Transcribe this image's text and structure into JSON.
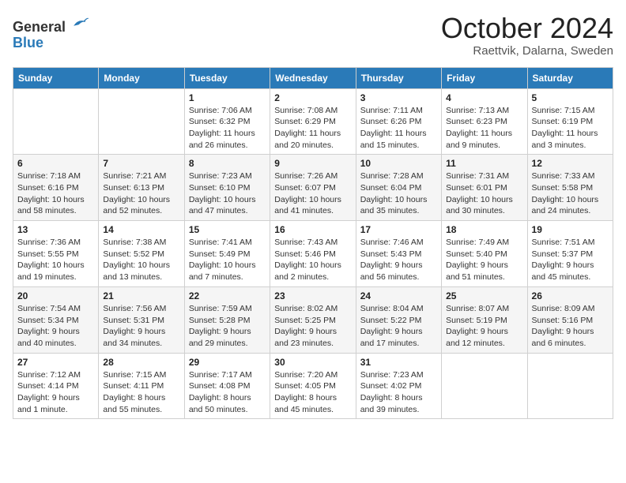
{
  "logo": {
    "general": "General",
    "blue": "Blue"
  },
  "header": {
    "month": "October 2024",
    "location": "Raettvik, Dalarna, Sweden"
  },
  "weekdays": [
    "Sunday",
    "Monday",
    "Tuesday",
    "Wednesday",
    "Thursday",
    "Friday",
    "Saturday"
  ],
  "weeks": [
    [
      {
        "day": "",
        "sunrise": "",
        "sunset": "",
        "daylight": ""
      },
      {
        "day": "",
        "sunrise": "",
        "sunset": "",
        "daylight": ""
      },
      {
        "day": "1",
        "sunrise": "Sunrise: 7:06 AM",
        "sunset": "Sunset: 6:32 PM",
        "daylight": "Daylight: 11 hours and 26 minutes."
      },
      {
        "day": "2",
        "sunrise": "Sunrise: 7:08 AM",
        "sunset": "Sunset: 6:29 PM",
        "daylight": "Daylight: 11 hours and 20 minutes."
      },
      {
        "day": "3",
        "sunrise": "Sunrise: 7:11 AM",
        "sunset": "Sunset: 6:26 PM",
        "daylight": "Daylight: 11 hours and 15 minutes."
      },
      {
        "day": "4",
        "sunrise": "Sunrise: 7:13 AM",
        "sunset": "Sunset: 6:23 PM",
        "daylight": "Daylight: 11 hours and 9 minutes."
      },
      {
        "day": "5",
        "sunrise": "Sunrise: 7:15 AM",
        "sunset": "Sunset: 6:19 PM",
        "daylight": "Daylight: 11 hours and 3 minutes."
      }
    ],
    [
      {
        "day": "6",
        "sunrise": "Sunrise: 7:18 AM",
        "sunset": "Sunset: 6:16 PM",
        "daylight": "Daylight: 10 hours and 58 minutes."
      },
      {
        "day": "7",
        "sunrise": "Sunrise: 7:21 AM",
        "sunset": "Sunset: 6:13 PM",
        "daylight": "Daylight: 10 hours and 52 minutes."
      },
      {
        "day": "8",
        "sunrise": "Sunrise: 7:23 AM",
        "sunset": "Sunset: 6:10 PM",
        "daylight": "Daylight: 10 hours and 47 minutes."
      },
      {
        "day": "9",
        "sunrise": "Sunrise: 7:26 AM",
        "sunset": "Sunset: 6:07 PM",
        "daylight": "Daylight: 10 hours and 41 minutes."
      },
      {
        "day": "10",
        "sunrise": "Sunrise: 7:28 AM",
        "sunset": "Sunset: 6:04 PM",
        "daylight": "Daylight: 10 hours and 35 minutes."
      },
      {
        "day": "11",
        "sunrise": "Sunrise: 7:31 AM",
        "sunset": "Sunset: 6:01 PM",
        "daylight": "Daylight: 10 hours and 30 minutes."
      },
      {
        "day": "12",
        "sunrise": "Sunrise: 7:33 AM",
        "sunset": "Sunset: 5:58 PM",
        "daylight": "Daylight: 10 hours and 24 minutes."
      }
    ],
    [
      {
        "day": "13",
        "sunrise": "Sunrise: 7:36 AM",
        "sunset": "Sunset: 5:55 PM",
        "daylight": "Daylight: 10 hours and 19 minutes."
      },
      {
        "day": "14",
        "sunrise": "Sunrise: 7:38 AM",
        "sunset": "Sunset: 5:52 PM",
        "daylight": "Daylight: 10 hours and 13 minutes."
      },
      {
        "day": "15",
        "sunrise": "Sunrise: 7:41 AM",
        "sunset": "Sunset: 5:49 PM",
        "daylight": "Daylight: 10 hours and 7 minutes."
      },
      {
        "day": "16",
        "sunrise": "Sunrise: 7:43 AM",
        "sunset": "Sunset: 5:46 PM",
        "daylight": "Daylight: 10 hours and 2 minutes."
      },
      {
        "day": "17",
        "sunrise": "Sunrise: 7:46 AM",
        "sunset": "Sunset: 5:43 PM",
        "daylight": "Daylight: 9 hours and 56 minutes."
      },
      {
        "day": "18",
        "sunrise": "Sunrise: 7:49 AM",
        "sunset": "Sunset: 5:40 PM",
        "daylight": "Daylight: 9 hours and 51 minutes."
      },
      {
        "day": "19",
        "sunrise": "Sunrise: 7:51 AM",
        "sunset": "Sunset: 5:37 PM",
        "daylight": "Daylight: 9 hours and 45 minutes."
      }
    ],
    [
      {
        "day": "20",
        "sunrise": "Sunrise: 7:54 AM",
        "sunset": "Sunset: 5:34 PM",
        "daylight": "Daylight: 9 hours and 40 minutes."
      },
      {
        "day": "21",
        "sunrise": "Sunrise: 7:56 AM",
        "sunset": "Sunset: 5:31 PM",
        "daylight": "Daylight: 9 hours and 34 minutes."
      },
      {
        "day": "22",
        "sunrise": "Sunrise: 7:59 AM",
        "sunset": "Sunset: 5:28 PM",
        "daylight": "Daylight: 9 hours and 29 minutes."
      },
      {
        "day": "23",
        "sunrise": "Sunrise: 8:02 AM",
        "sunset": "Sunset: 5:25 PM",
        "daylight": "Daylight: 9 hours and 23 minutes."
      },
      {
        "day": "24",
        "sunrise": "Sunrise: 8:04 AM",
        "sunset": "Sunset: 5:22 PM",
        "daylight": "Daylight: 9 hours and 17 minutes."
      },
      {
        "day": "25",
        "sunrise": "Sunrise: 8:07 AM",
        "sunset": "Sunset: 5:19 PM",
        "daylight": "Daylight: 9 hours and 12 minutes."
      },
      {
        "day": "26",
        "sunrise": "Sunrise: 8:09 AM",
        "sunset": "Sunset: 5:16 PM",
        "daylight": "Daylight: 9 hours and 6 minutes."
      }
    ],
    [
      {
        "day": "27",
        "sunrise": "Sunrise: 7:12 AM",
        "sunset": "Sunset: 4:14 PM",
        "daylight": "Daylight: 9 hours and 1 minute."
      },
      {
        "day": "28",
        "sunrise": "Sunrise: 7:15 AM",
        "sunset": "Sunset: 4:11 PM",
        "daylight": "Daylight: 8 hours and 55 minutes."
      },
      {
        "day": "29",
        "sunrise": "Sunrise: 7:17 AM",
        "sunset": "Sunset: 4:08 PM",
        "daylight": "Daylight: 8 hours and 50 minutes."
      },
      {
        "day": "30",
        "sunrise": "Sunrise: 7:20 AM",
        "sunset": "Sunset: 4:05 PM",
        "daylight": "Daylight: 8 hours and 45 minutes."
      },
      {
        "day": "31",
        "sunrise": "Sunrise: 7:23 AM",
        "sunset": "Sunset: 4:02 PM",
        "daylight": "Daylight: 8 hours and 39 minutes."
      },
      {
        "day": "",
        "sunrise": "",
        "sunset": "",
        "daylight": ""
      },
      {
        "day": "",
        "sunrise": "",
        "sunset": "",
        "daylight": ""
      }
    ]
  ]
}
